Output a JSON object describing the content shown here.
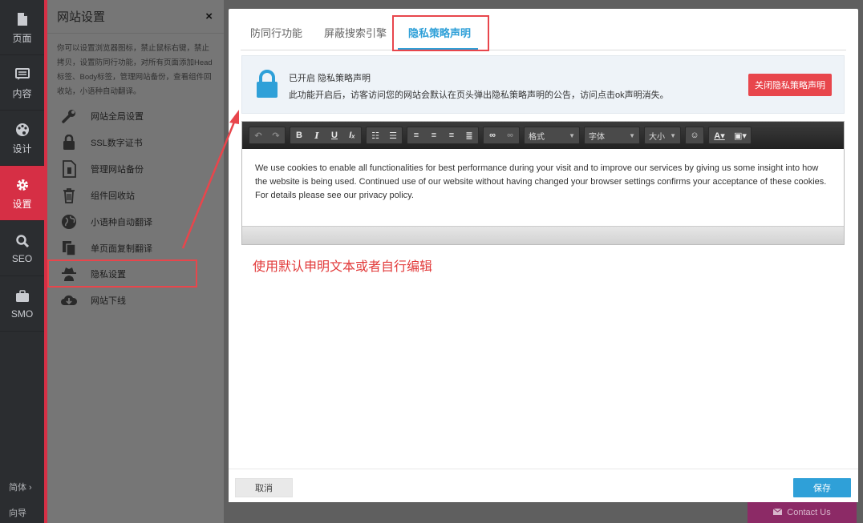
{
  "leftnav": {
    "items": [
      {
        "label": "页面",
        "icon": "page-icon"
      },
      {
        "label": "内容",
        "icon": "content-icon"
      },
      {
        "label": "设计",
        "icon": "palette-icon"
      },
      {
        "label": "设置",
        "icon": "gear-icon",
        "active": true
      },
      {
        "label": "SEO",
        "icon": "search-icon"
      },
      {
        "label": "SMO",
        "icon": "briefcase-icon"
      }
    ],
    "lang": "简体 ›",
    "guide": "向导"
  },
  "panel": {
    "title": "网站设置",
    "close": "×",
    "description": "你可以设置浏览器图标，禁止鼠标右键，禁止拷贝，设置防同行功能，对所有页面添加Head标签、Body标签，管理网站备份，查看组件回收站，小语种自动翻译。",
    "items": [
      {
        "label": "网站全局设置",
        "icon": "wrench-icon"
      },
      {
        "label": "SSL数字证书",
        "icon": "lock-icon"
      },
      {
        "label": "管理网站备份",
        "icon": "backup-file-icon"
      },
      {
        "label": "组件回收站",
        "icon": "trash-icon"
      },
      {
        "label": "小语种自动翻译",
        "icon": "globe-icon"
      },
      {
        "label": "单页面复制翻译",
        "icon": "copy-icon"
      },
      {
        "label": "隐私设置",
        "icon": "spy-icon"
      },
      {
        "label": "网站下线",
        "icon": "cloud-download-icon"
      }
    ]
  },
  "modal": {
    "tabs": [
      "防同行功能",
      "屏蔽搜索引擎",
      "隐私策略声明"
    ],
    "notice_title": "已开启 隐私策略声明",
    "notice_desc": "此功能开启后，访客访问您的网站会默认在页头弹出隐私策略声明的公告，访问点击ok声明消失。",
    "close_button": "关闭隐私策略声明",
    "toolbar": {
      "format": "格式",
      "font": "字体",
      "size": "大小"
    },
    "editor_text": "We use cookies to enable all functionalities for best performance during your visit and to improve our services by giving us some insight into how the website is being used. Continued use of our website without having changed your browser settings confirms your acceptance of these cookies. For details please see our privacy policy.",
    "annotation": "使用默认申明文本或者自行编辑",
    "cancel": "取消",
    "save": "保存"
  },
  "contact": "Contact Us",
  "colors": {
    "accent": "#2fa0d8",
    "danger": "#e8464c",
    "nav_active": "#d62f45"
  }
}
